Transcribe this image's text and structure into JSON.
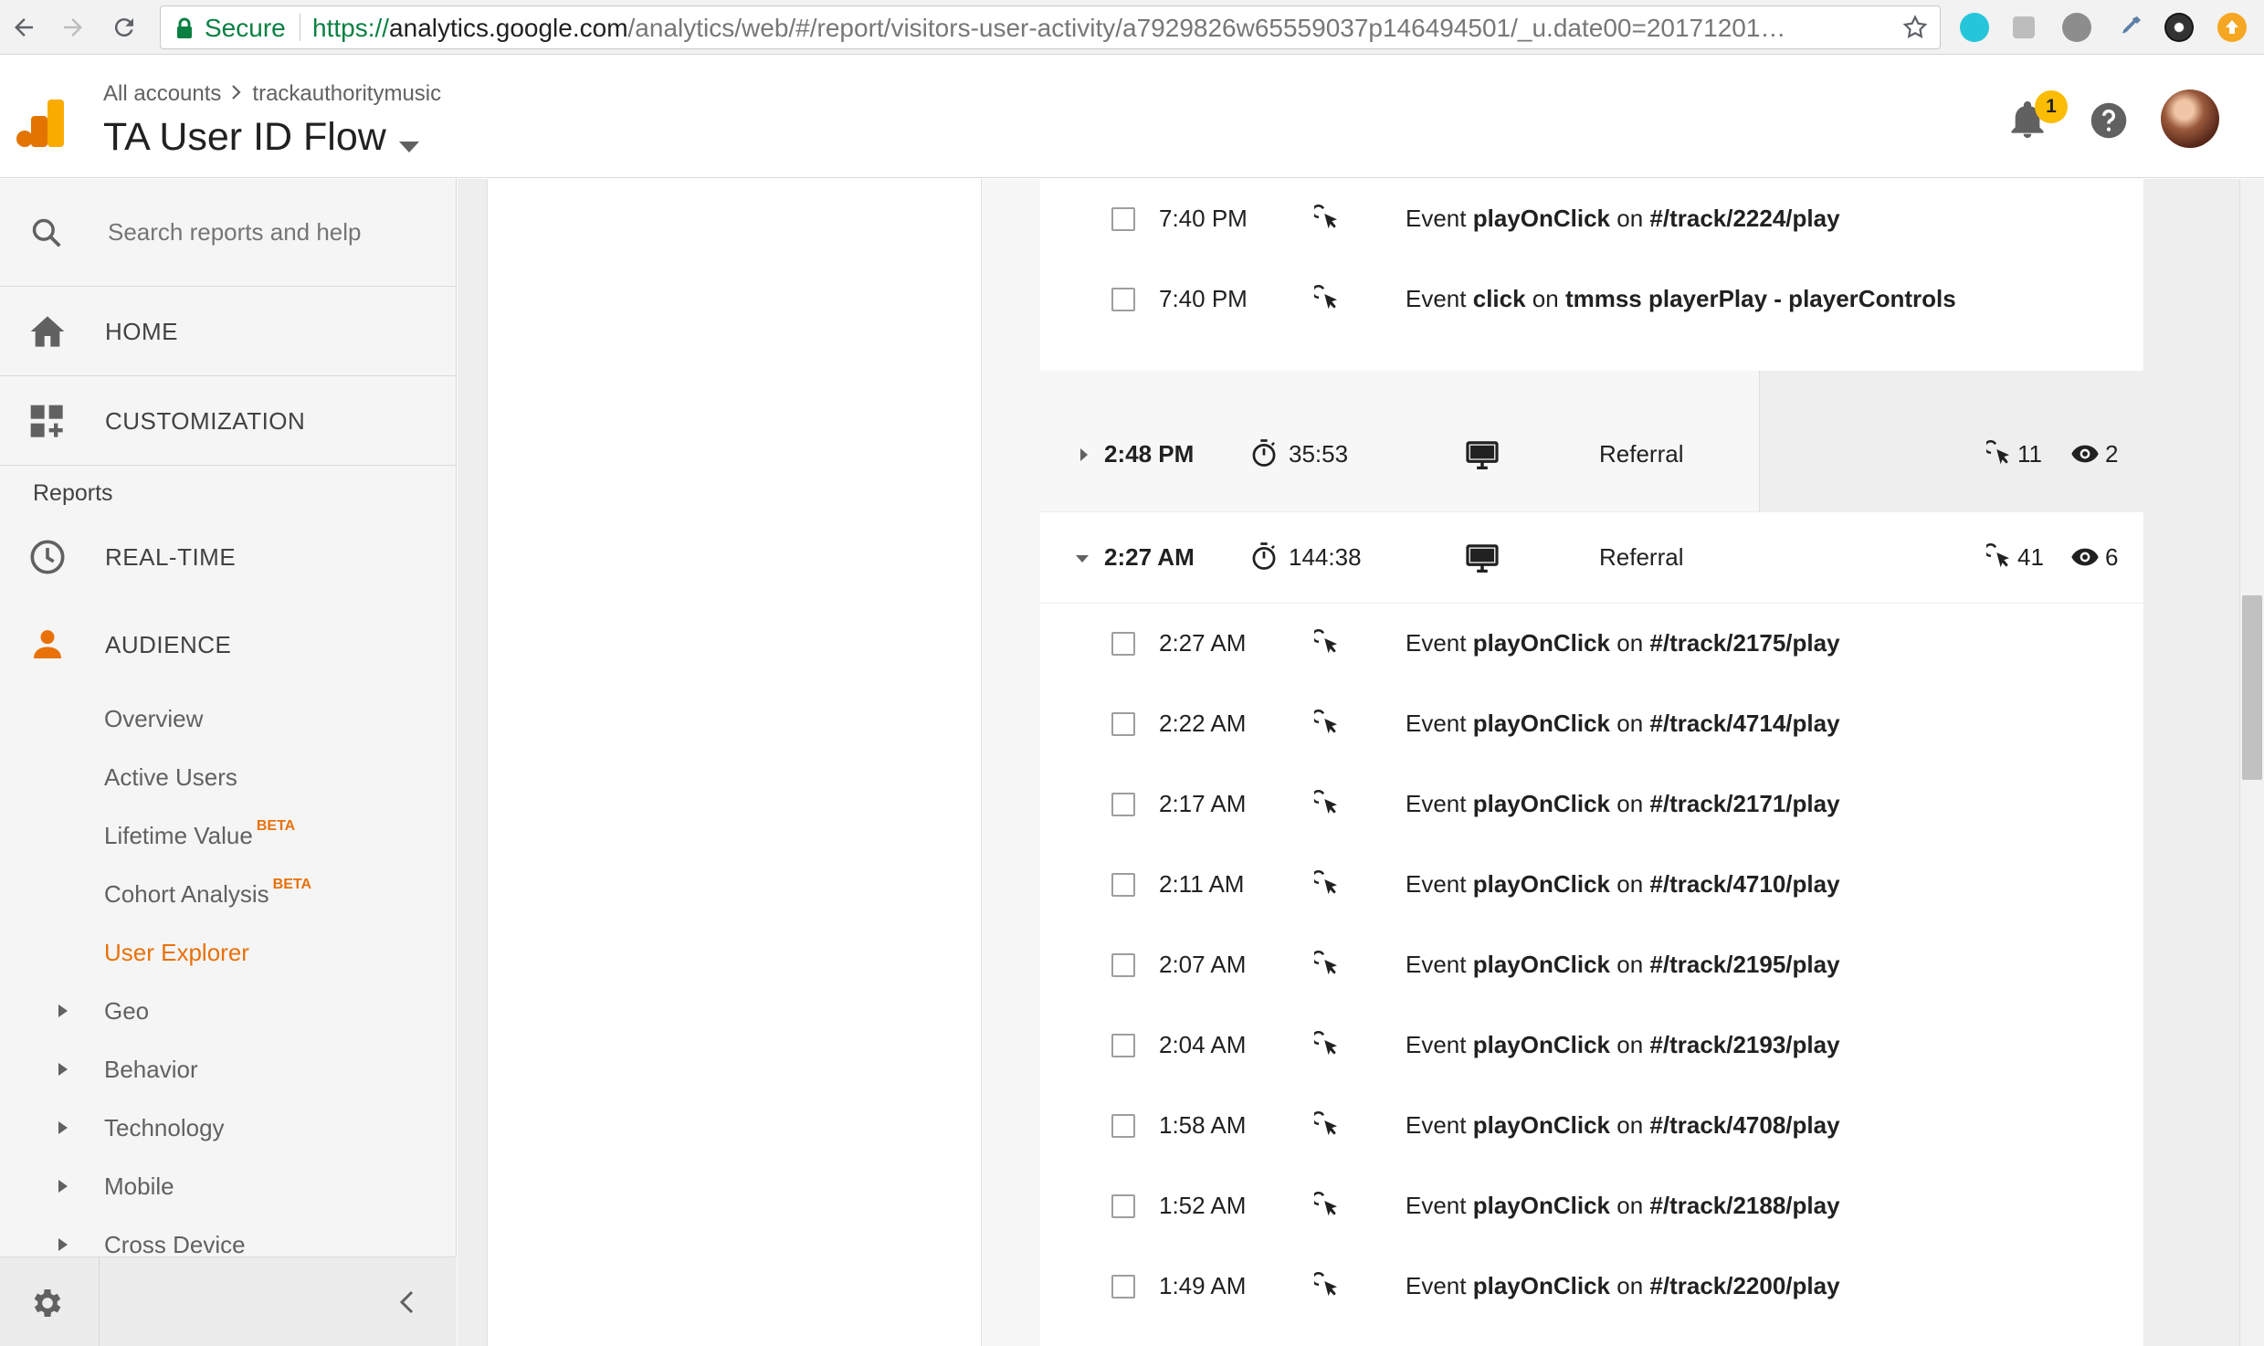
{
  "browser": {
    "secure_label": "Secure",
    "url_scheme": "https://",
    "url_host": "analytics.google.com",
    "url_path": "/analytics/web/#/report/visitors-user-activity/a7929826w65559037p146494501/_u.date00=20171201…"
  },
  "header": {
    "breadcrumb_root": "All accounts",
    "breadcrumb_account": "trackauthoritymusic",
    "view_title": "TA User ID Flow",
    "notification_count": "1"
  },
  "sidebar": {
    "search_placeholder": "Search reports and help",
    "home_label": "HOME",
    "customization_label": "CUSTOMIZATION",
    "reports_label": "Reports",
    "realtime_label": "REAL-TIME",
    "audience_label": "AUDIENCE",
    "beta_label": "BETA",
    "audience_items": [
      {
        "label": "Overview"
      },
      {
        "label": "Active Users"
      },
      {
        "label": "Lifetime Value"
      },
      {
        "label": "Cohort Analysis"
      },
      {
        "label": "User Explorer"
      },
      {
        "label": "Geo"
      },
      {
        "label": "Behavior"
      },
      {
        "label": "Technology"
      },
      {
        "label": "Mobile"
      },
      {
        "label": "Cross Device"
      }
    ]
  },
  "activity": {
    "event_prefix": "Event",
    "on_word": "on",
    "top_events": [
      {
        "time": "7:40 PM",
        "action": "playOnClick",
        "target": "#/track/2224/play"
      },
      {
        "time": "7:40 PM",
        "action": "click",
        "target": "tmmss playerPlay - playerControls"
      }
    ],
    "sessions": [
      {
        "start": "2:48 PM",
        "duration": "35:53",
        "channel": "Referral",
        "hits": "11",
        "pageviews": "2"
      },
      {
        "start": "2:27 AM",
        "duration": "144:38",
        "channel": "Referral",
        "hits": "41",
        "pageviews": "6"
      }
    ],
    "session_events": [
      {
        "time": "2:27 AM",
        "action": "playOnClick",
        "target": "#/track/2175/play"
      },
      {
        "time": "2:22 AM",
        "action": "playOnClick",
        "target": "#/track/4714/play"
      },
      {
        "time": "2:17 AM",
        "action": "playOnClick",
        "target": "#/track/2171/play"
      },
      {
        "time": "2:11 AM",
        "action": "playOnClick",
        "target": "#/track/4710/play"
      },
      {
        "time": "2:07 AM",
        "action": "playOnClick",
        "target": "#/track/2195/play"
      },
      {
        "time": "2:04 AM",
        "action": "playOnClick",
        "target": "#/track/2193/play"
      },
      {
        "time": "1:58 AM",
        "action": "playOnClick",
        "target": "#/track/4708/play"
      },
      {
        "time": "1:52 AM",
        "action": "playOnClick",
        "target": "#/track/2188/play"
      },
      {
        "time": "1:49 AM",
        "action": "playOnClick",
        "target": "#/track/2200/play"
      }
    ]
  },
  "colors": {
    "accent_orange": "#e8710a",
    "secure_green": "#0b8043",
    "badge_yellow": "#fbbc04"
  },
  "icons": {
    "event": "click-cursor-icon",
    "duration": "stopwatch-icon",
    "device": "desktop-icon",
    "pageviews": "eye-icon"
  }
}
